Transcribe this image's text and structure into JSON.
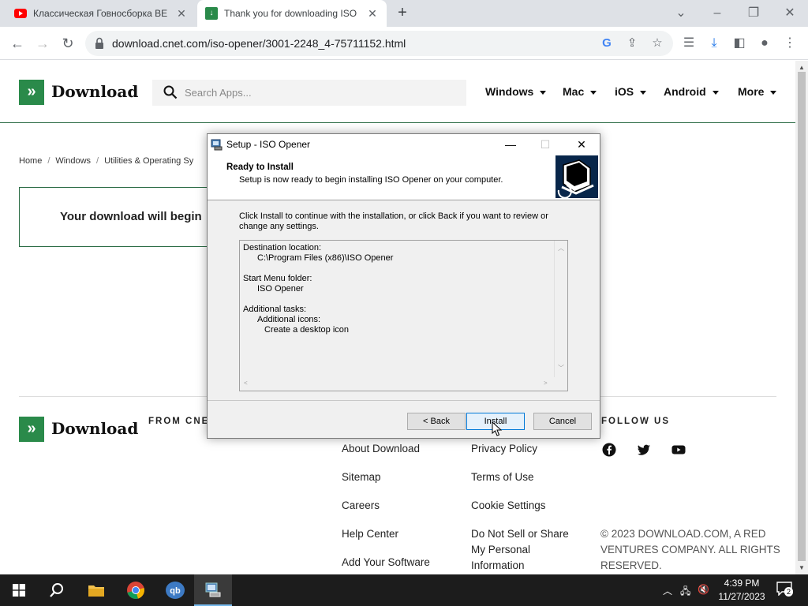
{
  "browser": {
    "tabs": [
      {
        "title": "Классическая Говносборка BES",
        "active": false
      },
      {
        "title": "Thank you for downloading ISO",
        "active": true
      }
    ],
    "url": "download.cnet.com/iso-opener/3001-2248_4-75711152.html"
  },
  "site": {
    "logo_text": "Download",
    "search_placeholder": "Search Apps...",
    "nav": [
      "Windows",
      "Mac",
      "iOS",
      "Android",
      "More"
    ],
    "breadcrumb": [
      "Home",
      "Windows",
      "Utilities & Operating Sy"
    ],
    "download_message": "Your download will begin"
  },
  "footer": {
    "logo_text": "Download",
    "from_heading": "FROM CNE",
    "follow_heading": "FOLLOW US",
    "col1": [
      "About Download",
      "Sitemap",
      "Careers",
      "Help Center",
      "Add Your Software"
    ],
    "col2": [
      "Privacy Policy",
      "Terms of Use",
      "Cookie Settings",
      "Do Not Sell or Share My Personal Information"
    ],
    "copyright": "© 2023 DOWNLOAD.COM, A RED VENTURES COMPANY. ALL RIGHTS RESERVED."
  },
  "dialog": {
    "title": "Setup - ISO Opener",
    "heading": "Ready to Install",
    "subheading": "Setup is now ready to begin installing ISO Opener on your computer.",
    "body": "Click Install to continue with the installation, or click Back if you want to review or change any settings.",
    "memo": {
      "dest_label": "Destination location:",
      "dest_value": "C:\\Program Files (x86)\\ISO Opener",
      "menu_label": "Start Menu folder:",
      "menu_value": "ISO Opener",
      "tasks_label": "Additional tasks:",
      "icons_label": "Additional icons:",
      "icons_value": "Create a desktop icon"
    },
    "buttons": {
      "back": "< Back",
      "install": "Install",
      "cancel": "Cancel"
    }
  },
  "taskbar": {
    "time": "4:39 PM",
    "date": "11/27/2023",
    "notifications": "2"
  }
}
